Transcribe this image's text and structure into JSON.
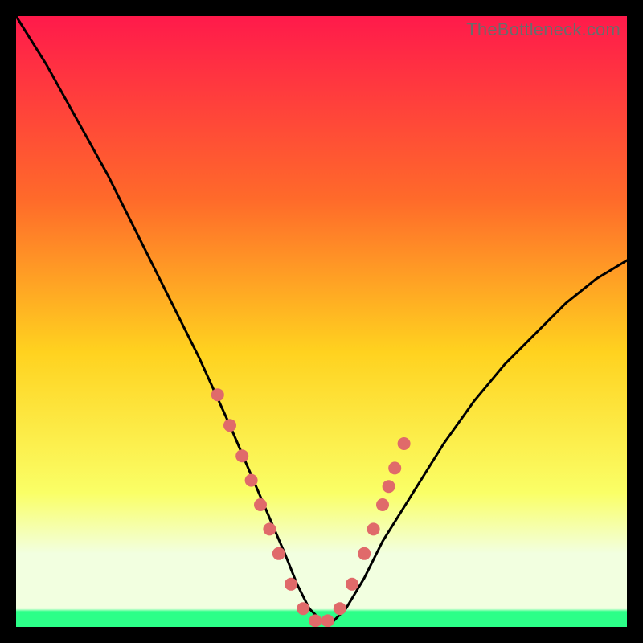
{
  "watermark": "TheBottleneck.com",
  "colors": {
    "bg": "#000000",
    "grad_top": "#ff1a4b",
    "grad_mid1": "#ff6a2a",
    "grad_mid2": "#ffd21f",
    "grad_mid3": "#faff66",
    "grad_bottom_band": "#f2ffe0",
    "grad_green": "#2cff88",
    "curve": "#000000",
    "dot": "#e06a6a"
  },
  "chart_data": {
    "type": "line",
    "title": "",
    "xlabel": "",
    "ylabel": "",
    "xlim": [
      0,
      100
    ],
    "ylim": [
      0,
      100
    ],
    "series": [
      {
        "name": "bottleneck-curve",
        "x": [
          0,
          5,
          10,
          15,
          20,
          25,
          30,
          35,
          38,
          41,
          44,
          46,
          48,
          50,
          52,
          54,
          57,
          60,
          65,
          70,
          75,
          80,
          85,
          90,
          95,
          100
        ],
        "y": [
          100,
          92,
          83,
          74,
          64,
          54,
          44,
          33,
          26,
          19,
          12,
          7,
          3,
          1,
          1,
          3,
          8,
          14,
          22,
          30,
          37,
          43,
          48,
          53,
          57,
          60
        ]
      }
    ],
    "markers": {
      "name": "highlight-dots",
      "x": [
        33,
        35,
        37,
        38.5,
        40,
        41.5,
        43,
        45,
        47,
        49,
        51,
        53,
        55,
        57,
        58.5,
        60,
        61,
        62,
        63.5
      ],
      "y": [
        38,
        33,
        28,
        24,
        20,
        16,
        12,
        7,
        3,
        1,
        1,
        3,
        7,
        12,
        16,
        20,
        23,
        26,
        30
      ]
    },
    "green_band_y_range": [
      0,
      3
    ],
    "pale_band_y_range": [
      3,
      14
    ]
  }
}
